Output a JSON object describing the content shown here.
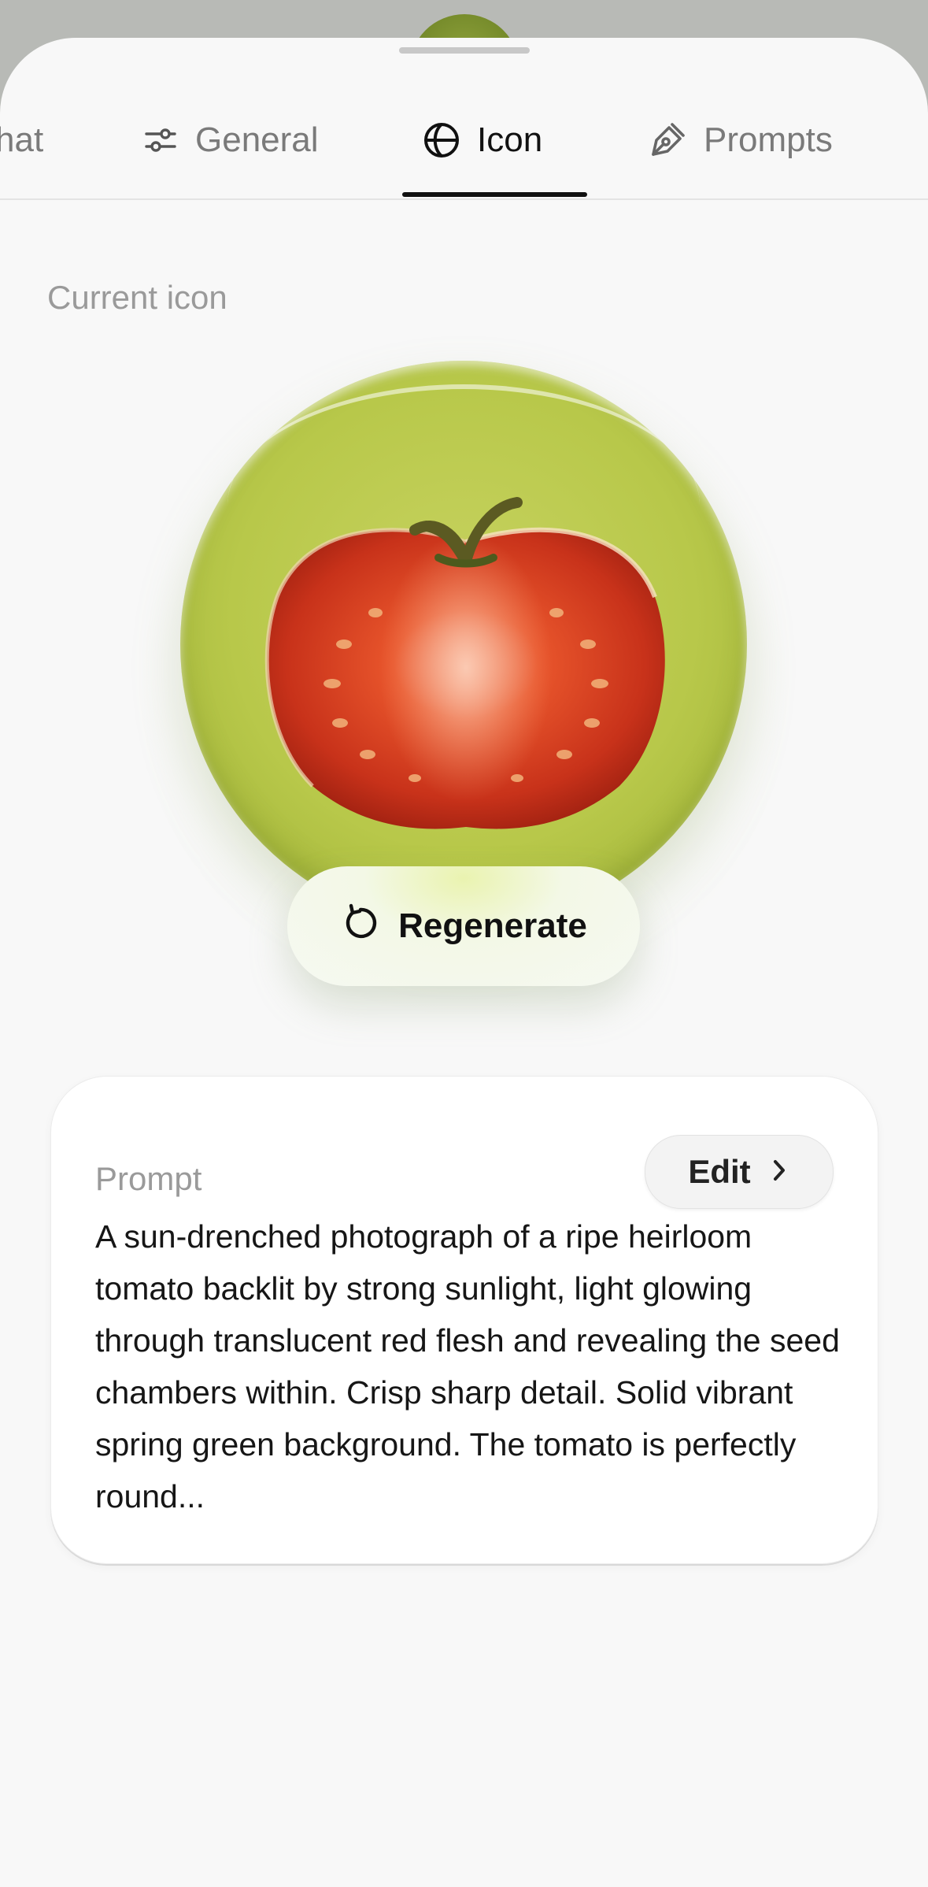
{
  "tabs": [
    {
      "label": "hat",
      "icon": "chat-icon"
    },
    {
      "label": "General",
      "icon": "sliders-icon"
    },
    {
      "label": "Icon",
      "icon": "globe-icon",
      "active": true
    },
    {
      "label": "Prompts",
      "icon": "pen-icon"
    }
  ],
  "icon_section": {
    "label": "Current icon",
    "image": "tomato-icon",
    "regenerate_label": "Regenerate"
  },
  "prompt_card": {
    "label": "Prompt",
    "edit_label": "Edit",
    "text": "A sun-drenched photograph of a ripe heirloom tomato backlit by strong sunlight, light glowing through translucent red flesh and revealing the seed chambers within. Crisp sharp detail. Solid vibrant spring green background. The tomato is perfectly round..."
  },
  "colors": {
    "sphere": "#b8c84a",
    "tomato": "#d6401a",
    "active_tab": "#111111"
  }
}
